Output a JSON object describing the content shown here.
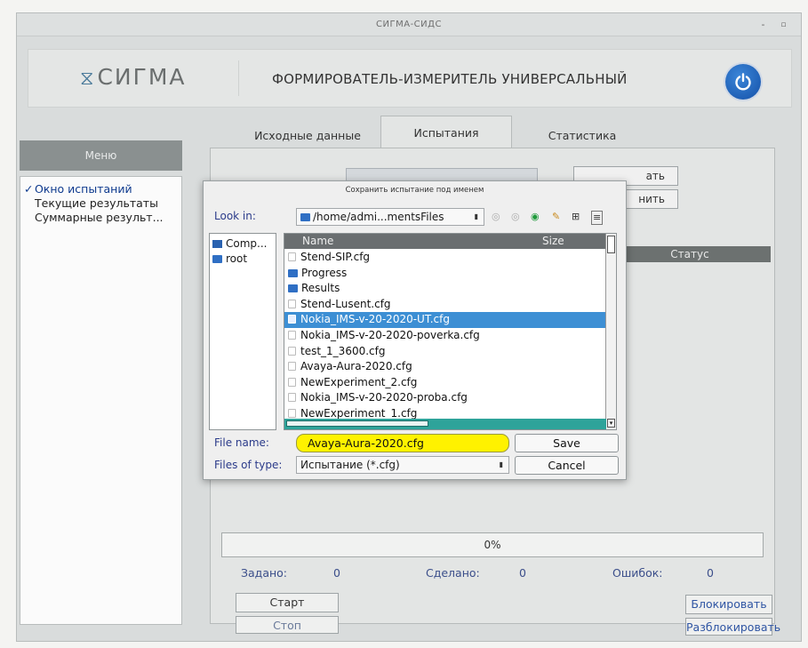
{
  "window": {
    "title": "СИГМА-СИДС",
    "min_glyph": "-",
    "close_glyph": "▫"
  },
  "header": {
    "logo_text": "СИГМА",
    "logo_mark": "⧖",
    "title": "ФОРМИРОВАТЕЛЬ-ИЗМЕРИТЕЛЬ УНИВЕРСАЛЬНЫЙ",
    "power_icon": "power-icon"
  },
  "menu": {
    "header": "Меню",
    "items": [
      {
        "label": "Окно испытаний",
        "active": true
      },
      {
        "label": "Текущие результаты",
        "active": false
      },
      {
        "label": "Суммарные результ...",
        "active": false
      }
    ]
  },
  "tabs": [
    {
      "label": "Исходные данные"
    },
    {
      "label": "Испытания"
    },
    {
      "label": "Статистика"
    }
  ],
  "panel": {
    "btn_partial_1": "ать",
    "btn_partial_2": "нить",
    "status_header": "Статус",
    "progress_text": "0%",
    "progress_value": 0,
    "stats": {
      "assigned_label": "Задано:",
      "assigned_value": "0",
      "done_label": "Сделано:",
      "done_value": "0",
      "errors_label": "Ошибок:",
      "errors_value": "0"
    },
    "buttons": {
      "start": "Старт",
      "stop": "Стоп",
      "block": "Блокировать",
      "unblock": "Разблокировать"
    }
  },
  "dialog": {
    "title": "Сохранить испытание под именем",
    "look_in_label": "Look in:",
    "look_in_value": "/home/admi...mentsFiles",
    "side": [
      {
        "label": "Comp...",
        "icon": "computer-icon"
      },
      {
        "label": "root",
        "icon": "folder-icon"
      }
    ],
    "columns": {
      "name": "Name",
      "size": "Size"
    },
    "files": [
      {
        "name": "Stend-SIP.cfg",
        "type": "file",
        "selected": false
      },
      {
        "name": "Progress",
        "type": "folder",
        "selected": false
      },
      {
        "name": "Results",
        "type": "folder",
        "selected": false
      },
      {
        "name": "Stend-Lusent.cfg",
        "type": "file",
        "selected": false
      },
      {
        "name": "Nokia_IMS-v-20-2020-UT.cfg",
        "type": "file",
        "selected": true
      },
      {
        "name": "Nokia_IMS-v-20-2020-poverka.cfg",
        "type": "file",
        "selected": false
      },
      {
        "name": "test_1_3600.cfg",
        "type": "file",
        "selected": false
      },
      {
        "name": "Avaya-Aura-2020.cfg",
        "type": "file",
        "selected": false
      },
      {
        "name": "NewExperiment_2.cfg",
        "type": "file",
        "selected": false
      },
      {
        "name": "Nokia_IMS-v-20-2020-proba.cfg",
        "type": "file",
        "selected": false
      },
      {
        "name": "NewExperiment_1.cfg",
        "type": "file",
        "selected": false
      }
    ],
    "file_name_label": "File name:",
    "file_name_value": "Avaya-Aura-2020.cfg",
    "files_of_type_label": "Files of type:",
    "files_of_type_value": "Испытание (*.cfg)",
    "save": "Save",
    "cancel": "Cancel"
  },
  "colors": {
    "accent": "#3d8fd4",
    "highlight": "#fff200",
    "menu_header": "#8a9090",
    "power": "#1f5fbf"
  }
}
